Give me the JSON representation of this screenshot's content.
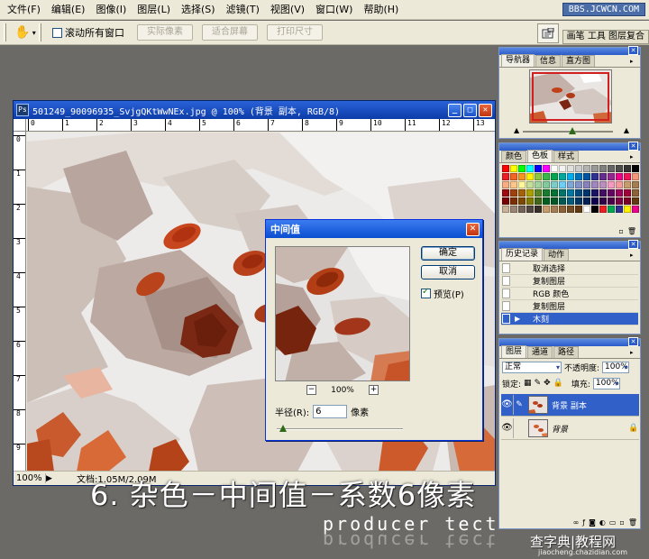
{
  "menubar": {
    "items": [
      "文件(F)",
      "编辑(E)",
      "图像(I)",
      "图层(L)",
      "选择(S)",
      "滤镜(T)",
      "视图(V)",
      "窗口(W)",
      "帮助(H)"
    ],
    "watermark": "BBS.JCWCN.COM"
  },
  "options": {
    "hand_icon": "hand-icon",
    "scroll_all_label": "滚动所有窗口",
    "scroll_all_checked": false,
    "actual_pixels": "实际像素",
    "fit_screen": "适合屏幕",
    "print_size": "打印尺寸",
    "palette_well_tabs": "画笔 工具 图层复合"
  },
  "document": {
    "title": "501249_90096935_SvjgQKtWwNEx.jpg @ 100% (背景 副本, RGB/8)",
    "ruler_h": [
      "0",
      "1",
      "2",
      "3",
      "4",
      "5",
      "6",
      "7",
      "8",
      "9",
      "10",
      "11",
      "12",
      "13"
    ],
    "ruler_v": [
      "0",
      "1",
      "2",
      "3",
      "4",
      "5",
      "6",
      "7",
      "8",
      "9"
    ],
    "zoom": "100%",
    "info": "文档:1.05M/2.09M"
  },
  "dialog": {
    "title": "中间值",
    "ok": "确定",
    "cancel": "取消",
    "preview_label": "预览(P)",
    "preview_checked": true,
    "zoom_minus": "−",
    "zoom_level": "100%",
    "zoom_plus": "+",
    "radius_label": "半径(R):",
    "radius_value": "6",
    "radius_unit": "像素",
    "radius_fraction": 0.05
  },
  "navigator": {
    "tabs": [
      "导航器",
      "信息",
      "直方图"
    ],
    "zoom_fraction": 0.55
  },
  "swatches": {
    "tabs": [
      "颜色",
      "色板",
      "样式"
    ],
    "colors": [
      "#ff0000",
      "#ffff00",
      "#00ff00",
      "#00ffff",
      "#0000ff",
      "#ff00ff",
      "#ffffff",
      "#f2f2f2",
      "#e0e0e0",
      "#cccccc",
      "#b3b3b3",
      "#999999",
      "#808080",
      "#666666",
      "#4d4d4d",
      "#333333",
      "#000000",
      "#ed1c24",
      "#f26522",
      "#f7941d",
      "#fff200",
      "#8dc63f",
      "#39b54a",
      "#00a651",
      "#00a99d",
      "#00aeef",
      "#0072bc",
      "#0054a6",
      "#2e3192",
      "#662d91",
      "#92278f",
      "#ec008c",
      "#ed145b",
      "#f7977a",
      "#f9ad81",
      "#fdc68a",
      "#fff79a",
      "#c4df9b",
      "#a3d39c",
      "#82ca9d",
      "#7bcdc8",
      "#6ecff6",
      "#7ea7d8",
      "#8393ca",
      "#8781bd",
      "#a187be",
      "#bc8dbf",
      "#f49ac2",
      "#f6989d",
      "#c69c6d",
      "#a67c52",
      "#9e0b0f",
      "#a0410d",
      "#a36209",
      "#aba000",
      "#598527",
      "#197b30",
      "#007236",
      "#00746b",
      "#0076a3",
      "#004a80",
      "#003471",
      "#1b1464",
      "#440e62",
      "#630460",
      "#9e005d",
      "#9e0039",
      "#8c6239",
      "#790000",
      "#7b2e00",
      "#7d4900",
      "#827b00",
      "#406618",
      "#005e20",
      "#005826",
      "#005952",
      "#005b7f",
      "#003663",
      "#002157",
      "#0d004c",
      "#32004b",
      "#4b0049",
      "#7b0046",
      "#7a0026",
      "#603913",
      "#c7b299",
      "#998675",
      "#736357",
      "#534741",
      "#37302a",
      "#c69c6d",
      "#a67c52",
      "#8c6239",
      "#754c24",
      "#603913",
      "#ffffff",
      "#000000",
      "#ee1d24",
      "#00a651",
      "#2e3192",
      "#fff200",
      "#ec008c"
    ]
  },
  "history": {
    "tabs": [
      "历史记录",
      "动作"
    ],
    "items": [
      "取消选择",
      "复制图层",
      "RGB 颜色",
      "复制图层",
      "木刻"
    ],
    "selected_index": 4
  },
  "layers": {
    "tabs": [
      "图层",
      "通道",
      "路径"
    ],
    "blend_mode": "正常",
    "opacity_label": "不透明度:",
    "opacity": "100%",
    "lock_label": "锁定:",
    "fill_label": "填充:",
    "fill": "100%",
    "items": [
      {
        "name": "背景 副本",
        "selected": true,
        "locked": false
      },
      {
        "name": "背景",
        "selected": false,
        "locked": true
      }
    ]
  },
  "overlay": {
    "caption": "6. 杂色－中间值－系数6像素",
    "credit": "producer tect",
    "site_mark": "查字典|教程网",
    "site_url": "jiaocheng.chazidian.com"
  }
}
